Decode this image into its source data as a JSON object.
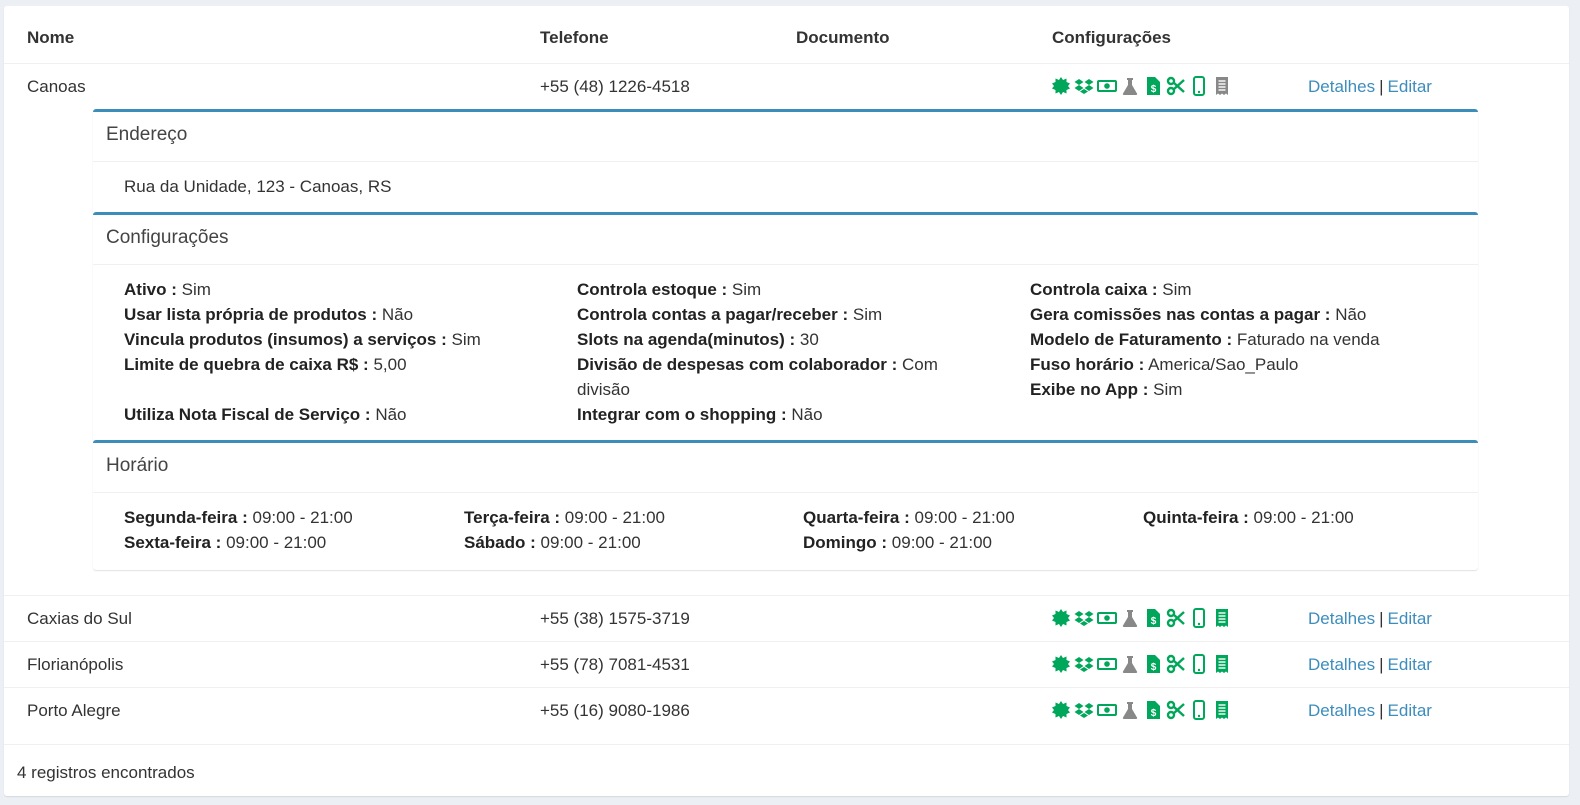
{
  "table": {
    "headers": {
      "nome": "Nome",
      "telefone": "Telefone",
      "documento": "Documento",
      "configuracoes": "Configurações"
    },
    "rows": [
      {
        "nome": "Canoas",
        "telefone": "+55 (48) 1226-4518",
        "documento": ""
      },
      {
        "nome": "Caxias do Sul",
        "telefone": "+55 (38) 1575-3719",
        "documento": ""
      },
      {
        "nome": "Florianópolis",
        "telefone": "+55 (78) 7081-4531",
        "documento": ""
      },
      {
        "nome": "Porto Alegre",
        "telefone": "+55 (16) 9080-1986",
        "documento": ""
      }
    ],
    "links": {
      "detalhes": "Detalhes",
      "separator": "|",
      "editar": "Editar"
    },
    "config_icons": [
      "certificate-icon",
      "dropbox-icon",
      "money-icon",
      "flask-icon",
      "invoice-dollar-icon",
      "scissors-icon",
      "mobile-icon",
      "receipt-icon"
    ]
  },
  "colors": {
    "icon_active": "#00a65a",
    "icon_inactive": "#888888",
    "link": "#3c8dbc",
    "panel_border": "#3c8dbc"
  },
  "details": {
    "endereco": {
      "title": "Endereço",
      "value": "Rua da Unidade, 123 - Canoas, RS"
    },
    "configuracoes": {
      "title": "Configurações",
      "col1": [
        {
          "label": "Ativo :",
          "value": "Sim"
        },
        {
          "label": "Usar lista própria de produtos :",
          "value": "Não"
        },
        {
          "label": "Vincula produtos (insumos) a serviços :",
          "value": "Sim"
        },
        {
          "label": "Limite de quebra de caixa R$ :",
          "value": "5,00"
        },
        {
          "label": "Utiliza Nota Fiscal de Serviço :",
          "value": "Não"
        }
      ],
      "col2": [
        {
          "label": "Controla estoque :",
          "value": "Sim"
        },
        {
          "label": "Controla contas a pagar/receber :",
          "value": "Sim"
        },
        {
          "label": "Slots na agenda(minutos) :",
          "value": "30"
        },
        {
          "label": "Divisão de despesas com colaborador :",
          "value": "Com divisão"
        },
        {
          "label": "Integrar com o shopping :",
          "value": "Não"
        }
      ],
      "col3": [
        {
          "label": "Controla caixa :",
          "value": "Sim"
        },
        {
          "label": "Gera comissões nas contas a pagar :",
          "value": "Não"
        },
        {
          "label": "Modelo de Faturamento :",
          "value": "Faturado na venda"
        },
        {
          "label": "Fuso horário :",
          "value": "America/Sao_Paulo"
        },
        {
          "label": "Exibe no App :",
          "value": "Sim"
        }
      ]
    },
    "horario": {
      "title": "Horário",
      "days": [
        {
          "label": "Segunda-feira :",
          "value": "09:00 - 21:00"
        },
        {
          "label": "Terça-feira :",
          "value": "09:00 - 21:00"
        },
        {
          "label": "Quarta-feira :",
          "value": "09:00 - 21:00"
        },
        {
          "label": "Quinta-feira :",
          "value": "09:00 - 21:00"
        },
        {
          "label": "Sexta-feira :",
          "value": "09:00 - 21:00"
        },
        {
          "label": "Sábado :",
          "value": "09:00 - 21:00"
        },
        {
          "label": "Domingo :",
          "value": "09:00 - 21:00"
        }
      ]
    }
  },
  "footer": {
    "count_text": "4 registros encontrados"
  }
}
